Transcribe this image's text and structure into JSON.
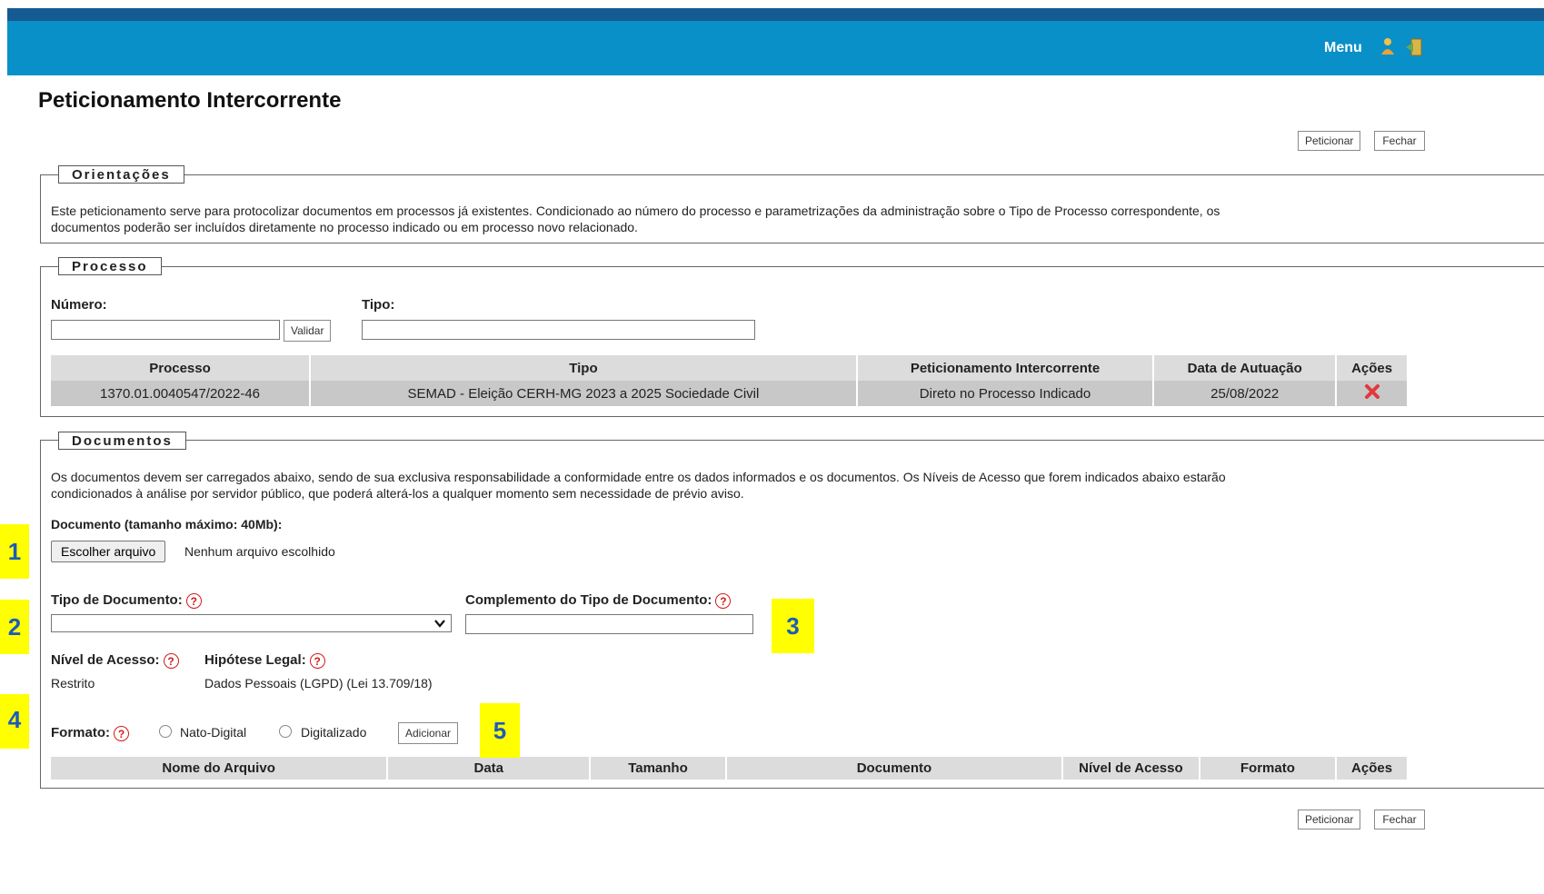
{
  "header": {
    "menu_label": "Menu",
    "icons": [
      "user-icon",
      "exit-icon"
    ]
  },
  "page": {
    "title": "Peticionamento Intercorrente"
  },
  "top_buttons": {
    "peticionar": "Peticionar",
    "fechar": "Fechar"
  },
  "orientacoes": {
    "legend": "Orientações",
    "text_line1": "Este peticionamento serve para protocolizar documentos em processos já existentes. Condicionado ao número do processo e parametrizações da administração sobre o Tipo de Processo correspondente, os",
    "text_line2": "documentos poderão ser incluídos diretamente no processo indicado ou em processo novo relacionado."
  },
  "processo": {
    "legend": "Processo",
    "numero_label": "Número:",
    "validar_button": "Validar",
    "tipo_label": "Tipo:",
    "table": {
      "headers": [
        "Processo",
        "Tipo",
        "Peticionamento Intercorrente",
        "Data de Autuação",
        "Ações"
      ],
      "rows": [
        {
          "processo": "1370.01.0040547/2022-46",
          "tipo": "SEMAD - Eleição CERH-MG 2023 a 2025 Sociedade Civil",
          "peticionamento": "Direto no Processo Indicado",
          "data": "25/08/2022",
          "acao_icon": "delete-x-icon"
        }
      ]
    }
  },
  "documentos": {
    "legend": "Documentos",
    "text_line1": "Os documentos devem ser carregados abaixo, sendo de sua exclusiva responsabilidade a conformidade entre os dados informados e os documentos. Os Níveis de Acesso que forem indicados abaixo estarão",
    "text_line2": "condicionados à análise por servidor público, que poderá alterá-los a qualquer momento sem necessidade de prévio aviso.",
    "documento_label": "Documento (tamanho máximo: 40Mb):",
    "choose_file_button": "Escolher arquivo",
    "no_file_text": "Nenhum arquivo escolhido",
    "tipo_documento_label": "Tipo de Documento:",
    "complemento_label": "Complemento do Tipo de Documento:",
    "nivel_acesso_label": "Nível de Acesso:",
    "nivel_acesso_value": "Restrito",
    "hipotese_label": "Hipótese Legal:",
    "hipotese_value": "Dados Pessoais (LGPD) (Lei 13.709/18)",
    "formato_label": "Formato:",
    "radio_nato": "Nato-Digital",
    "radio_digitalizado": "Digitalizado",
    "adicionar_button": "Adicionar",
    "table_headers": [
      "Nome do Arquivo",
      "Data",
      "Tamanho",
      "Documento",
      "Nível de Acesso",
      "Formato",
      "Ações"
    ]
  },
  "bottom_buttons": {
    "peticionar": "Peticionar",
    "fechar": "Fechar"
  },
  "annotations": [
    "1",
    "2",
    "3",
    "4",
    "5"
  ],
  "colors": {
    "header_bar": "#0a90c8",
    "header_top": "#155a92",
    "annotation_bg": "#ffff00",
    "annotation_text": "#1e5bb8",
    "help_icon": "#d21a1a"
  }
}
